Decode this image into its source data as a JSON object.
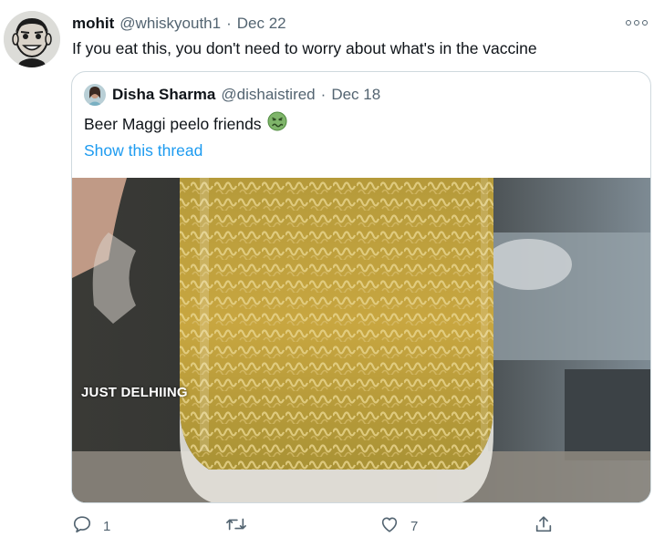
{
  "tweet": {
    "author_name": "mohit",
    "author_handle": "@whiskyouth1",
    "separator": "·",
    "date": "Dec 22",
    "text": "If you eat this, you don't need to worry about what's in the vaccine"
  },
  "quoted_tweet": {
    "author_name": "Disha Sharma",
    "author_handle": "@dishaistired",
    "separator": "·",
    "date": "Dec 18",
    "text": "Beer Maggi peelo friends",
    "emoji": "nauseated-face",
    "thread_link": "Show this thread",
    "media_watermark": "JUST DELHIING"
  },
  "actions": {
    "reply_icon": "reply-icon",
    "reply_count": "1",
    "retweet_icon": "retweet-icon",
    "retweet_count": "",
    "like_icon": "heart-icon",
    "like_count": "7",
    "share_icon": "share-icon"
  },
  "colors": {
    "text_primary": "#0f1419",
    "text_secondary": "#536471",
    "link": "#1d9bf0",
    "border": "#cfd9de"
  }
}
